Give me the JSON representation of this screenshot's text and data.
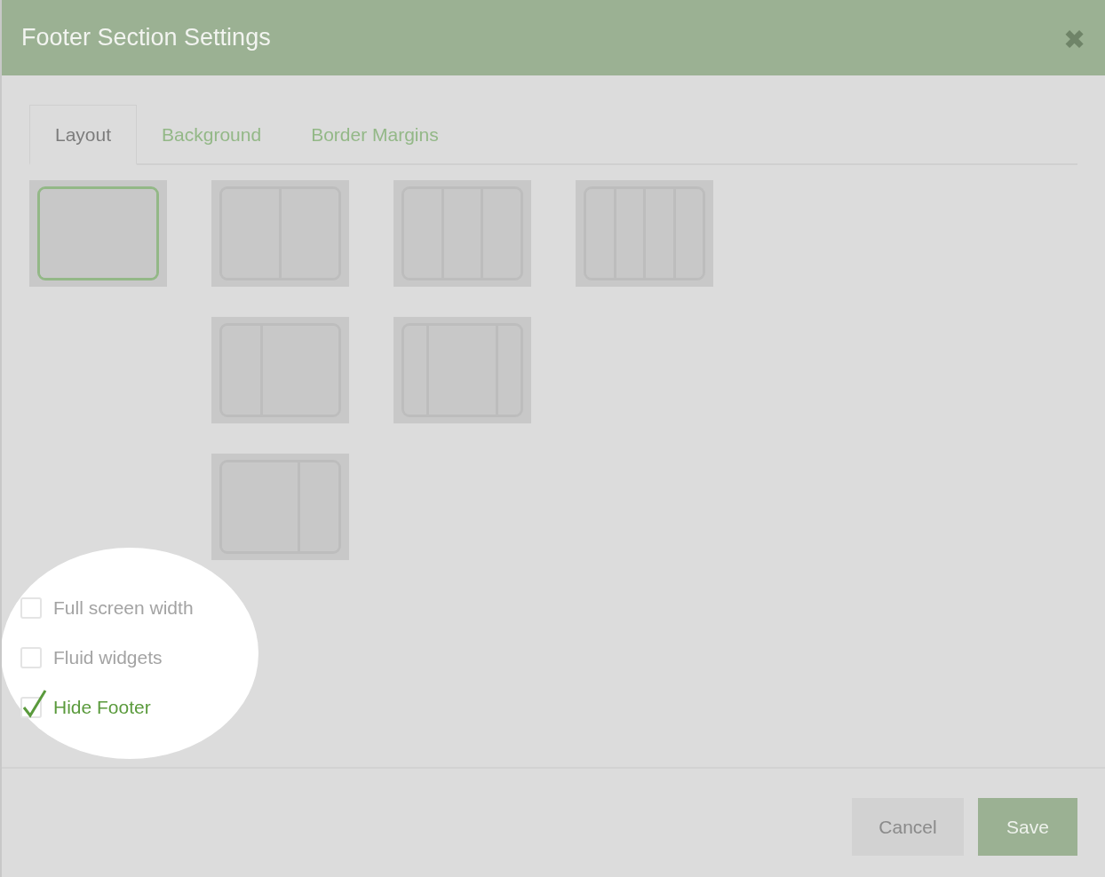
{
  "window": {
    "title": "Footer Section Settings",
    "close": "✖"
  },
  "tabs": [
    {
      "label": "Layout",
      "selected": true
    },
    {
      "label": "Background",
      "selected": false
    },
    {
      "label": "Border Margins",
      "selected": false
    }
  ],
  "layout_rows": [
    [
      {
        "kind": "single",
        "selected": true
      },
      {
        "kind": "halves",
        "selected": false
      },
      {
        "kind": "thirds",
        "selected": false
      },
      {
        "kind": "quarters",
        "selected": false
      }
    ],
    [
      {
        "kind": "narrow-left",
        "selected": false
      },
      {
        "kind": "wide-center",
        "selected": false
      }
    ],
    [
      {
        "kind": "narrow-right",
        "selected": false
      }
    ]
  ],
  "options": [
    {
      "label": "Full screen width",
      "checked": false
    },
    {
      "label": "Fluid widgets",
      "checked": false
    },
    {
      "label": "Hide Footer",
      "checked": true
    }
  ],
  "buttons": [
    {
      "label": "Cancel",
      "kind": "secondary"
    },
    {
      "label": "Save",
      "kind": "primary"
    }
  ]
}
